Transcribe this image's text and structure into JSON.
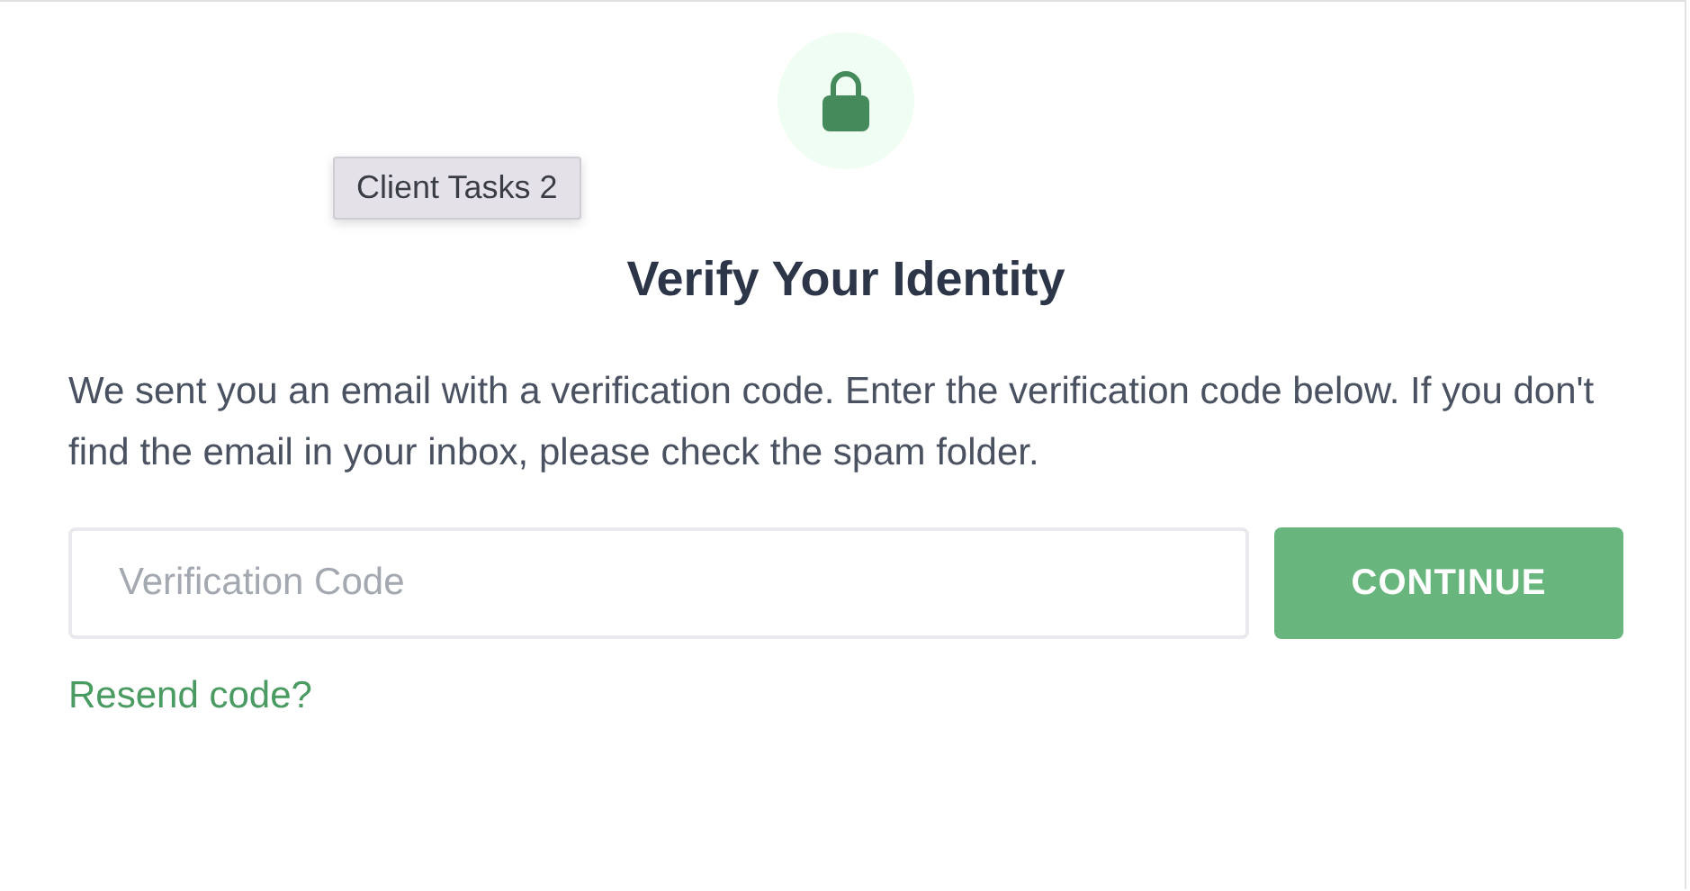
{
  "tooltip": {
    "text": "Client Tasks 2"
  },
  "title": "Verify Your Identity",
  "message": "We sent you an email with a verification code. Enter the verification code below. If you don't find the email in your inbox, please check the spam folder.",
  "code_field": {
    "placeholder": "Verification Code"
  },
  "continue_button": {
    "label": "CONTINUE"
  },
  "resend_link": {
    "label": "Resend code?"
  }
}
